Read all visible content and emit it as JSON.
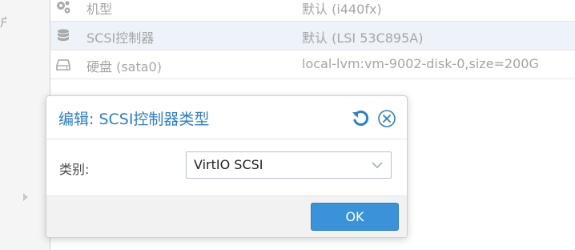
{
  "left_nav": {
    "fragment": "户"
  },
  "rows": [
    {
      "icon": "gears-icon",
      "key": "机型",
      "value": "默认 (i440fx)"
    },
    {
      "icon": "database-icon",
      "key": "SCSI控制器",
      "value": "默认 (LSI 53C895A)"
    },
    {
      "icon": "hard-disk-icon",
      "key": "硬盘 (sata0)",
      "value": "local-lvm:vm-9002-disk-0,size=200G"
    }
  ],
  "dialog": {
    "title": "编辑: SCSI控制器类型",
    "field_label": "类别:",
    "select_value": "VirtIO SCSI",
    "ok_label": "OK"
  },
  "colors": {
    "accent": "#2e7fc4",
    "button": "#3a92d8",
    "selected_row": "#eef3fa"
  }
}
